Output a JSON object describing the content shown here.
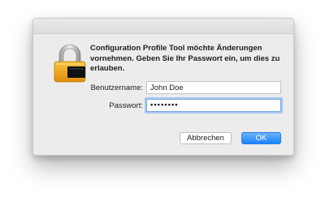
{
  "dialog": {
    "message": "Configuration Profile Tool möchte Änderungen vornehmen. Geben Sie Ihr Passwort ein, um dies zu erlauben.",
    "icon": "lock-icon",
    "username_label": "Benutzername:",
    "username_value": "John Doe",
    "password_label": "Passwort:",
    "password_value": "••••••••",
    "cancel_label": "Abbrechen",
    "ok_label": "OK"
  },
  "colors": {
    "accent": "#1a82fb",
    "focus_ring": "#a9c8f0",
    "lock_body": "#f2a81e"
  }
}
